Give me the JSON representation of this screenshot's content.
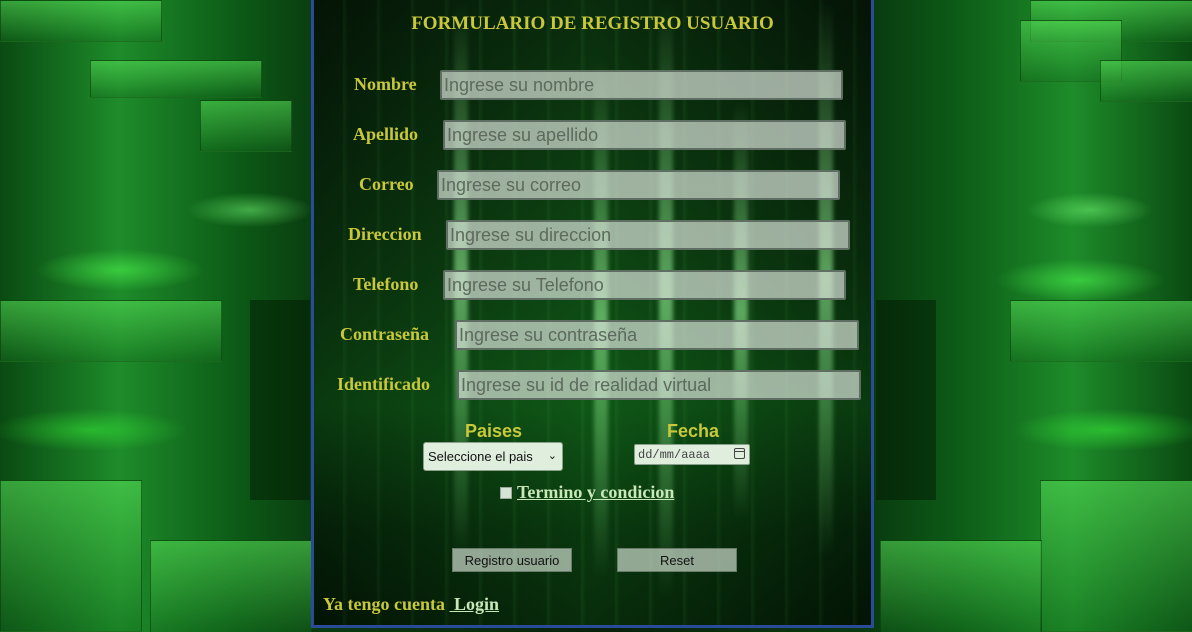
{
  "form": {
    "title": "FORMULARIO DE REGISTRO USUARIO",
    "fields": [
      {
        "label": "Nombre",
        "placeholder": "Ingrese su nombre"
      },
      {
        "label": "Apellido",
        "placeholder": "Ingrese su apellido"
      },
      {
        "label": "Correo",
        "placeholder": "Ingrese su correo"
      },
      {
        "label": "Direccion",
        "placeholder": "Ingrese su direccion"
      },
      {
        "label": "Telefono",
        "placeholder": "Ingrese su Telefono"
      },
      {
        "label": "Contraseña",
        "placeholder": "Ingrese su contraseña"
      },
      {
        "label": "Identificado",
        "placeholder": "Ingrese su id de realidad virtual"
      }
    ],
    "country": {
      "label": "Paises",
      "selected": "Seleccione el pais"
    },
    "date": {
      "label": "Fecha",
      "placeholder": "dd/mm/aaaa"
    },
    "terms_label": "Termino y condicion",
    "buttons": {
      "register": "Registro usuario",
      "reset": "Reset"
    },
    "footer": {
      "text": "Ya tengo cuenta",
      "login_link": "Login"
    }
  },
  "colors": {
    "label": "#c8c83a",
    "link": "#c8e8b8",
    "panel_border": "#2a4a9a"
  },
  "icons": {
    "select_chevron": "chevron-down-icon",
    "date_picker": "calendar-icon"
  }
}
